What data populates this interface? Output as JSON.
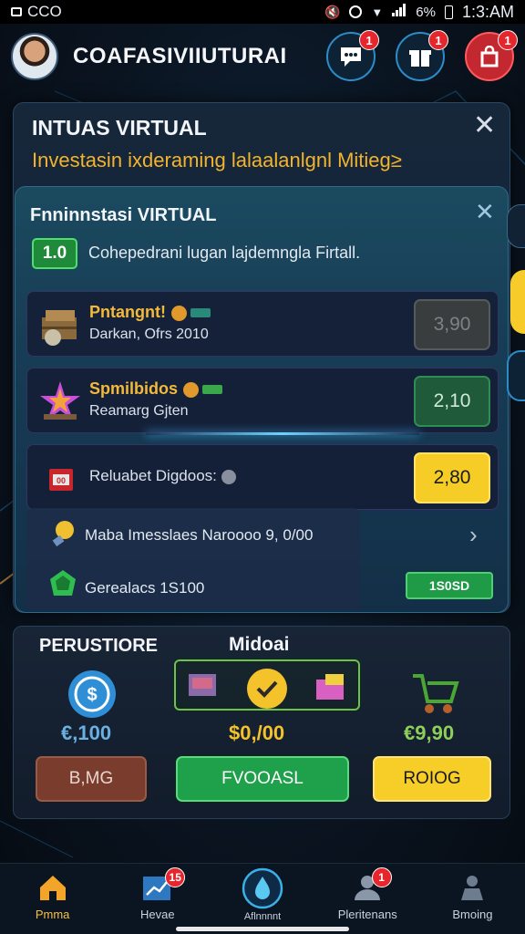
{
  "status_bar": {
    "left_text": "CCO",
    "battery": "6%",
    "time": "1:3:AM"
  },
  "header": {
    "app_title": "COAFASIVIIUTURAI",
    "buttons": [
      {
        "icon": "chat-icon",
        "badge": "1"
      },
      {
        "icon": "gift-icon",
        "badge": "1"
      },
      {
        "icon": "bag-icon",
        "badge": "1"
      }
    ]
  },
  "outer_card": {
    "title": "INTUAS VIRTUAL",
    "subtitle": "Investasin ixderaming lalaalanlgnl Mitieg≥"
  },
  "inner_card": {
    "title": "Fnninnstasi VIRTUAL",
    "tag": "1.0",
    "description": "Cohepedrani lugan lajdemngla Firtall.",
    "rows": [
      {
        "name": "Pntangnt!",
        "sub": "Darkan, Ofrs 2010",
        "value": "3,90",
        "icon": "treasure-chest-icon",
        "style": "gray"
      },
      {
        "name": "Spmilbidos",
        "sub": "Reamarg Gjten",
        "value": "2,10",
        "icon": "star-shield-icon",
        "style": "green"
      },
      {
        "name": "",
        "sub": "Reluabet Digdoos:",
        "value": "2,80",
        "icon": "red-box-icon",
        "style": "yellow"
      }
    ],
    "list": [
      {
        "text": "Maba Imesslaes Naroooo 9, 0/00",
        "icon": "lightbulb-icon"
      },
      {
        "text": "Gerealacs 1S100",
        "icon": "green-gem-icon"
      }
    ],
    "pill_label": "1S0SD"
  },
  "panel": {
    "left_label": "PERUSTIORE",
    "mid_label": "Midoai",
    "columns": [
      {
        "price": "€,100",
        "icon": "blue-coin-icon",
        "button": "B,MG"
      },
      {
        "price": "$0,/00",
        "icon": "check-badge-icon",
        "button": "FVOOASL"
      },
      {
        "price": "€9,90",
        "icon": "cart-icon",
        "button": "ROIOG"
      }
    ]
  },
  "bottom_nav": [
    {
      "label": "Pmma",
      "icon": "home-icon"
    },
    {
      "label": "Hevae",
      "icon": "chart-icon",
      "badge": "15"
    },
    {
      "label": "Aflnnnnt",
      "icon": "drop-icon"
    },
    {
      "label": "Pleritenans",
      "icon": "user-icon",
      "badge": "1"
    },
    {
      "label": "Bmoing",
      "icon": "person-icon"
    }
  ]
}
